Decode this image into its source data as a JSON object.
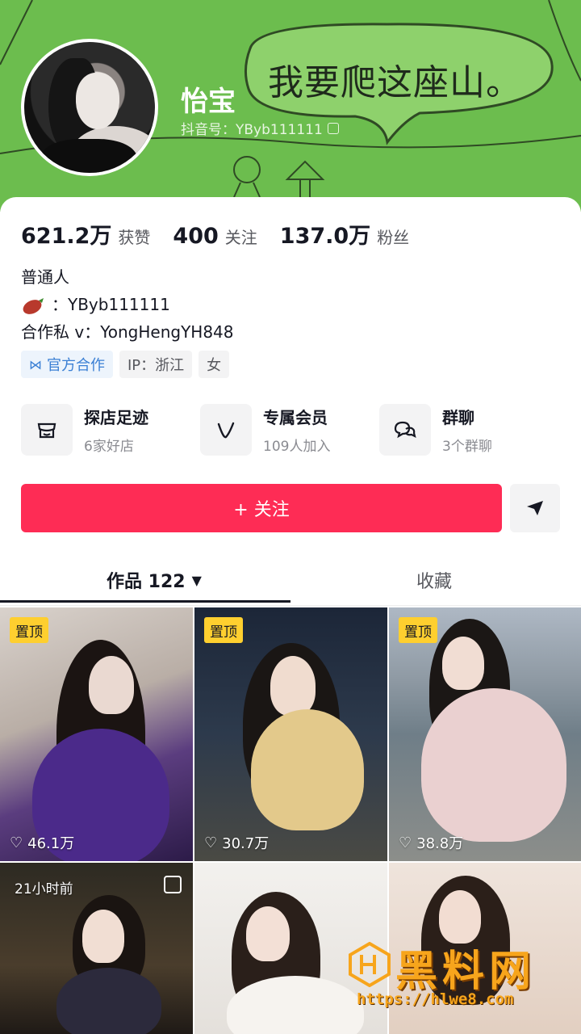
{
  "profile": {
    "nickname": "怡宝",
    "douyin_id": "抖音号：YByb111111",
    "banner_text": "我要爬这座山。"
  },
  "stats": [
    {
      "num": "621.2万",
      "label": "获赞"
    },
    {
      "num": "400",
      "label": "关注"
    },
    {
      "num": "137.0万",
      "label": "粉丝"
    }
  ],
  "bio": {
    "line1": "普通人",
    "line2": "：YByb111111",
    "line3": "合作私 v：YongHengYH848"
  },
  "tags": {
    "official": "官方合作",
    "ip": "IP：浙江",
    "gender": "女"
  },
  "features": [
    {
      "title": "探店足迹",
      "sub": "6家好店",
      "icon": "store-icon"
    },
    {
      "title": "专属会员",
      "sub": "109人加入",
      "icon": "vip-icon"
    },
    {
      "title": "群聊",
      "sub": "3个群聊",
      "icon": "chat-icon"
    }
  ],
  "actions": {
    "follow": "+ 关注"
  },
  "tabs": {
    "works": "作品 122",
    "favorites": "收藏"
  },
  "posts": [
    {
      "pin": "置顶",
      "likes": "46.1万"
    },
    {
      "pin": "置顶",
      "likes": "30.7万"
    },
    {
      "pin": "置顶",
      "likes": "38.8万"
    },
    {
      "time": "21小时前"
    },
    {},
    {}
  ],
  "watermark": {
    "title": "黑料网",
    "url": "https://hlwe8.com"
  },
  "colors": {
    "banner": "#6cbd4e",
    "follow": "#fe2c55",
    "pin": "#fecf2f"
  }
}
